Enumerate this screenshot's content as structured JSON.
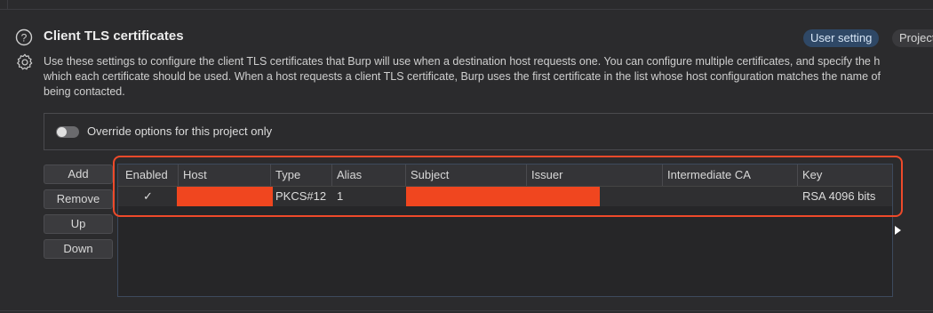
{
  "section": {
    "title": "Client TLS certificates",
    "tags": {
      "user": "User setting",
      "project": "Project"
    },
    "description_lines": [
      "Use these settings to configure the client TLS certificates that Burp will use when a destination host requests one. You can configure multiple certificates, and specify the h",
      "which each certificate should be used. When a host requests a client TLS certificate, Burp uses the first certificate in the list whose host configuration matches the name of",
      "being contacted."
    ]
  },
  "override": {
    "label": "Override options for this project only",
    "enabled": false
  },
  "buttons": {
    "add": "Add",
    "remove": "Remove",
    "up": "Up",
    "down": "Down"
  },
  "table": {
    "columns": [
      "Enabled",
      "Host",
      "Type",
      "Alias",
      "Subject",
      "Issuer",
      "Intermediate CA",
      "Key"
    ],
    "rows": [
      {
        "enabled": "✓",
        "host": "",
        "type": "PKCS#12",
        "alias": "1",
        "subject": "",
        "issuer": "",
        "intermediate_ca": "",
        "key": "RSA 4096 bits"
      }
    ]
  },
  "colors": {
    "highlight": "#ee4a2a",
    "redaction": "#f0461f",
    "tag_user_bg": "#2f4866"
  },
  "icons": {
    "help": "help-circle-icon",
    "settings": "gear-icon",
    "expand": "arrow-right-icon"
  }
}
